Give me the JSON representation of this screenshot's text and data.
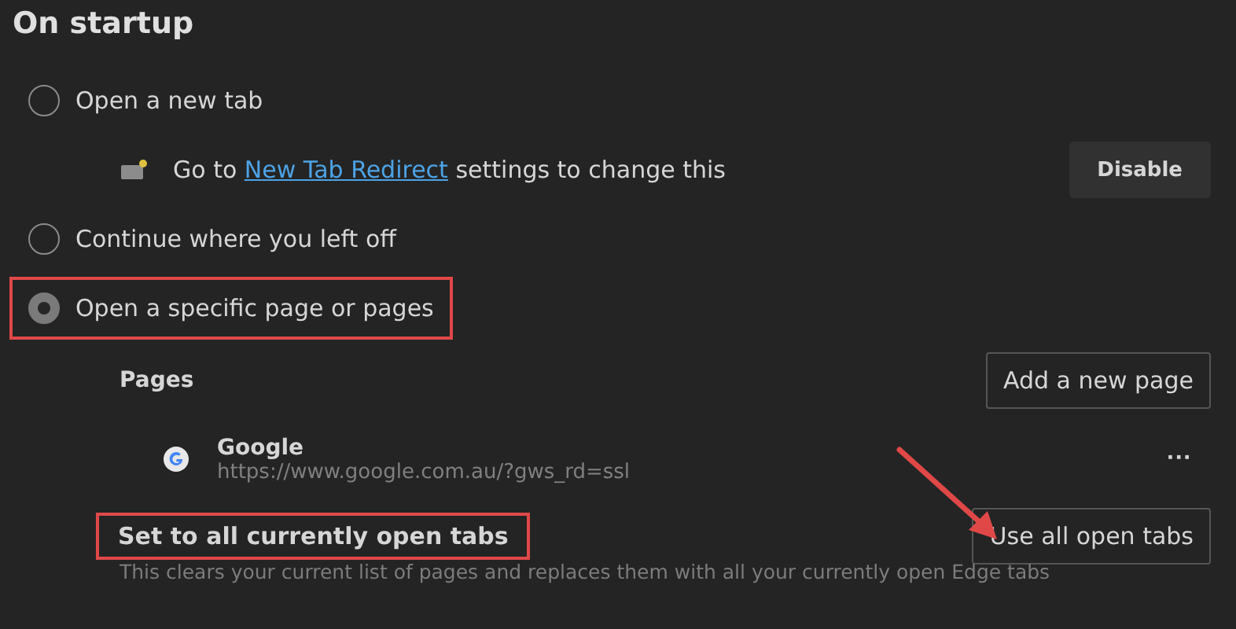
{
  "heading": "On startup",
  "options": [
    {
      "label": "Open a new tab",
      "selected": false,
      "highlighted": false
    },
    {
      "label": "Continue where you left off",
      "selected": false,
      "highlighted": false
    },
    {
      "label": "Open a specific page or pages",
      "selected": true,
      "highlighted": true
    }
  ],
  "extension_notice": {
    "prefix": "Go to",
    "link": "New Tab Redirect",
    "suffix": "settings to change this",
    "button": "Disable"
  },
  "pages": {
    "title": "Pages",
    "add_button": "Add a new page",
    "items": [
      {
        "name": "Google",
        "url": "https://www.google.com.au/?gws_rd=ssl",
        "menu": "···"
      }
    ]
  },
  "open_tabs": {
    "title": "Set to all currently open tabs",
    "highlighted": true,
    "description": "This clears your current list of pages and replaces them with all your currently open Edge tabs",
    "button": "Use all open tabs"
  },
  "annotation_arrow": true
}
